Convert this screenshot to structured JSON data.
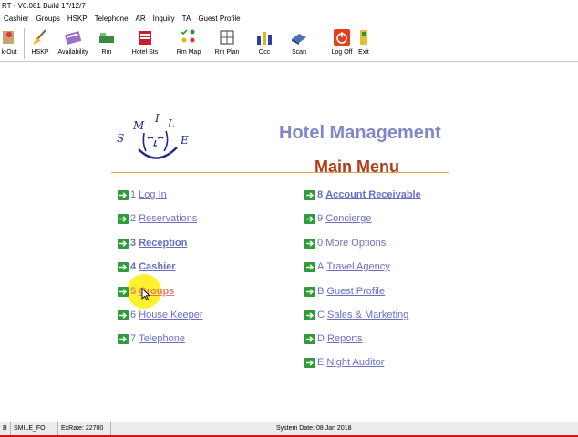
{
  "titlebar": {
    "text": "RT - V6.081 Build 17/12/7"
  },
  "menubar": [
    "Cashier",
    "Groups",
    "HSKP",
    "Telephone",
    "AR",
    "Inquiry",
    "TA",
    "Guest Profile"
  ],
  "toolbar": {
    "checkout": "k-Out",
    "hskp": "HSKP",
    "availability": "Availability",
    "rm": "Rm",
    "hotel_sts": "Hotel Sts",
    "rm_map": "Rm Map",
    "rm_plan": "Rm Plan",
    "occ": "Occ",
    "scan": "Scan",
    "logoff": "Log Off",
    "exit": "Exit"
  },
  "logo": {
    "letters": [
      "S",
      "M",
      "I",
      "L",
      "E"
    ]
  },
  "header": {
    "title": "Hotel Management",
    "subtitle": "Main Menu"
  },
  "menu_left": [
    {
      "num": "1",
      "label": "Log In"
    },
    {
      "num": "2",
      "label": "Reservations"
    },
    {
      "num": "3",
      "label": "Reception"
    },
    {
      "num": "4",
      "label": "Cashier"
    },
    {
      "num": "5",
      "label": "Groups"
    },
    {
      "num": "6",
      "label": "House Keeper"
    },
    {
      "num": "7",
      "label": "Telephone"
    }
  ],
  "menu_right": [
    {
      "num": "8",
      "label": "Account Receivable"
    },
    {
      "num": "9",
      "label": "Concierge"
    },
    {
      "num": "0",
      "label": "More Options"
    },
    {
      "num": "A",
      "label": "Travel Agency"
    },
    {
      "num": "B",
      "label": "Guest Profile"
    },
    {
      "num": "C",
      "label": "Sales & Marketing"
    },
    {
      "num": "D",
      "label": "Reports"
    },
    {
      "num": "E",
      "label": "Night Auditor"
    }
  ],
  "status": {
    "cell1": "B",
    "user": "SMILE_FO",
    "exrate": "ExRate: 22700",
    "sysdate": "System Date: 08 Jan 2018"
  },
  "colors": {
    "title": "#8187c9",
    "main_menu": "#b23a16",
    "link": "#6a6fc4",
    "arrow": "#2f9d37",
    "divider": "#e0a34a"
  }
}
